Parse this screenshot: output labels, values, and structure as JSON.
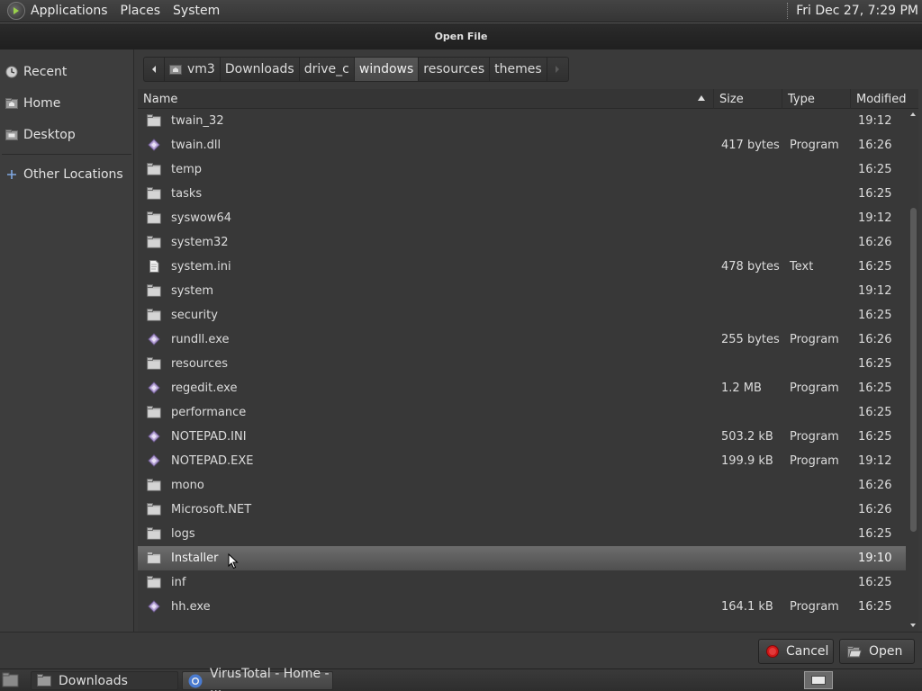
{
  "top_panel": {
    "menus": [
      "Applications",
      "Places",
      "System"
    ],
    "clock": "Fri Dec 27,  7:29 PM"
  },
  "dialog": {
    "title": "Open File",
    "sidebar": [
      {
        "label": "Recent",
        "icon": "clock-icon"
      },
      {
        "label": "Home",
        "icon": "home-folder-icon"
      },
      {
        "label": "Desktop",
        "icon": "desktop-folder-icon"
      },
      {
        "label": "Other Locations",
        "icon": "plus-icon"
      }
    ],
    "path": [
      "vm3",
      "Downloads",
      "drive_c",
      "windows",
      "resources",
      "themes"
    ],
    "active_crumb": "windows",
    "columns": {
      "name": "Name",
      "size": "Size",
      "type": "Type",
      "modified": "Modified"
    },
    "sort": {
      "column": "Name",
      "direction": "descending"
    },
    "files": [
      {
        "name": "twain_32",
        "kind": "folder",
        "size": "",
        "type": "",
        "modified": "19:12"
      },
      {
        "name": "twain.dll",
        "kind": "program",
        "size": "417 bytes",
        "type": "Program",
        "modified": "16:26"
      },
      {
        "name": "temp",
        "kind": "folder",
        "size": "",
        "type": "",
        "modified": "16:25"
      },
      {
        "name": "tasks",
        "kind": "folder",
        "size": "",
        "type": "",
        "modified": "16:25"
      },
      {
        "name": "syswow64",
        "kind": "folder",
        "size": "",
        "type": "",
        "modified": "19:12"
      },
      {
        "name": "system32",
        "kind": "folder",
        "size": "",
        "type": "",
        "modified": "16:26"
      },
      {
        "name": "system.ini",
        "kind": "text",
        "size": "478 bytes",
        "type": "Text",
        "modified": "16:25"
      },
      {
        "name": "system",
        "kind": "folder",
        "size": "",
        "type": "",
        "modified": "19:12"
      },
      {
        "name": "security",
        "kind": "folder",
        "size": "",
        "type": "",
        "modified": "16:25"
      },
      {
        "name": "rundll.exe",
        "kind": "program",
        "size": "255 bytes",
        "type": "Program",
        "modified": "16:26"
      },
      {
        "name": "resources",
        "kind": "folder",
        "size": "",
        "type": "",
        "modified": "16:25"
      },
      {
        "name": "regedit.exe",
        "kind": "program",
        "size": "1.2 MB",
        "type": "Program",
        "modified": "16:25"
      },
      {
        "name": "performance",
        "kind": "folder",
        "size": "",
        "type": "",
        "modified": "16:25"
      },
      {
        "name": "NOTEPAD.INI",
        "kind": "program",
        "size": "503.2 kB",
        "type": "Program",
        "modified": "16:25"
      },
      {
        "name": "NOTEPAD.EXE",
        "kind": "program",
        "size": "199.9 kB",
        "type": "Program",
        "modified": "19:12"
      },
      {
        "name": "mono",
        "kind": "folder",
        "size": "",
        "type": "",
        "modified": "16:26"
      },
      {
        "name": "Microsoft.NET",
        "kind": "folder",
        "size": "",
        "type": "",
        "modified": "16:26"
      },
      {
        "name": "logs",
        "kind": "folder",
        "size": "",
        "type": "",
        "modified": "16:25"
      },
      {
        "name": "Installer",
        "kind": "folder",
        "size": "",
        "type": "",
        "modified": "19:10",
        "selected": true
      },
      {
        "name": "inf",
        "kind": "folder",
        "size": "",
        "type": "",
        "modified": "16:25"
      },
      {
        "name": "hh.exe",
        "kind": "program",
        "size": "164.1 kB",
        "type": "Program",
        "modified": "16:25"
      }
    ],
    "buttons": {
      "cancel": "Cancel",
      "open": "Open"
    }
  },
  "taskbar": {
    "tasks": [
      {
        "label": "Downloads",
        "icon": "folder-icon",
        "active": false
      },
      {
        "label": "VirusTotal - Home - ...",
        "icon": "chrome-icon",
        "active": true
      }
    ]
  },
  "colors": {
    "background": "#3a3a3a",
    "selection": "#5e5e5e",
    "cancel_icon": "#d01818"
  }
}
